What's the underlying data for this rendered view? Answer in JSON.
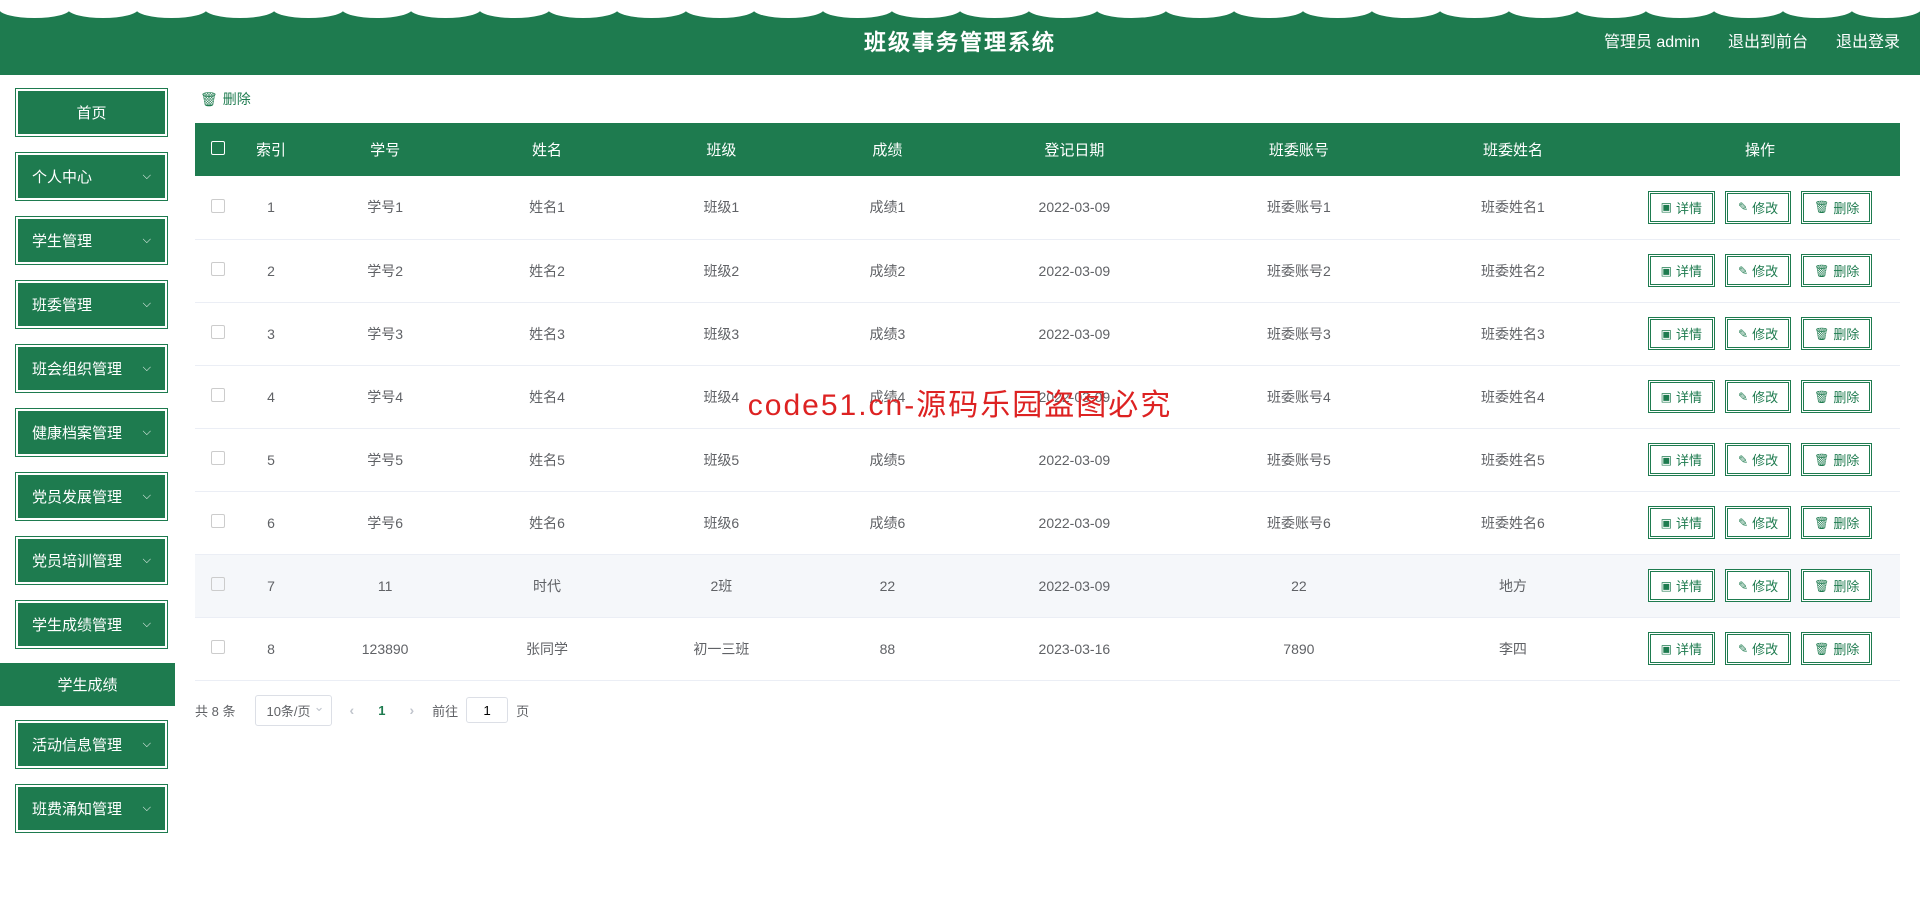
{
  "header": {
    "title": "班级事务管理系统"
  },
  "nav": {
    "admin": "管理员 admin",
    "front": "退出到前台",
    "logout": "退出登录"
  },
  "sidebar": {
    "items": [
      {
        "label": "首页",
        "expandable": false
      },
      {
        "label": "个人中心",
        "expandable": true
      },
      {
        "label": "学生管理",
        "expandable": true
      },
      {
        "label": "班委管理",
        "expandable": true
      },
      {
        "label": "班会组织管理",
        "expandable": true
      },
      {
        "label": "健康档案管理",
        "expandable": true
      },
      {
        "label": "党员发展管理",
        "expandable": true
      },
      {
        "label": "党员培训管理",
        "expandable": true
      },
      {
        "label": "学生成绩管理",
        "expandable": true,
        "expanded": true
      },
      {
        "label": "活动信息管理",
        "expandable": true
      },
      {
        "label": "班费涌知管理",
        "expandable": true
      }
    ],
    "submenu": "学生成绩"
  },
  "toolbar": {
    "delete": "删除"
  },
  "table": {
    "headers": {
      "index": "索引",
      "studentId": "学号",
      "name": "姓名",
      "className": "班级",
      "grade": "成绩",
      "date": "登记日期",
      "committeeAccount": "班委账号",
      "committeeName": "班委姓名",
      "operation": "操作"
    },
    "rows": [
      {
        "index": "1",
        "studentId": "学号1",
        "name": "姓名1",
        "className": "班级1",
        "grade": "成绩1",
        "date": "2022-03-09",
        "committeeAccount": "班委账号1",
        "committeeName": "班委姓名1"
      },
      {
        "index": "2",
        "studentId": "学号2",
        "name": "姓名2",
        "className": "班级2",
        "grade": "成绩2",
        "date": "2022-03-09",
        "committeeAccount": "班委账号2",
        "committeeName": "班委姓名2"
      },
      {
        "index": "3",
        "studentId": "学号3",
        "name": "姓名3",
        "className": "班级3",
        "grade": "成绩3",
        "date": "2022-03-09",
        "committeeAccount": "班委账号3",
        "committeeName": "班委姓名3"
      },
      {
        "index": "4",
        "studentId": "学号4",
        "name": "姓名4",
        "className": "班级4",
        "grade": "成绩4",
        "date": "2022-03-09",
        "committeeAccount": "班委账号4",
        "committeeName": "班委姓名4"
      },
      {
        "index": "5",
        "studentId": "学号5",
        "name": "姓名5",
        "className": "班级5",
        "grade": "成绩5",
        "date": "2022-03-09",
        "committeeAccount": "班委账号5",
        "committeeName": "班委姓名5"
      },
      {
        "index": "6",
        "studentId": "学号6",
        "name": "姓名6",
        "className": "班级6",
        "grade": "成绩6",
        "date": "2022-03-09",
        "committeeAccount": "班委账号6",
        "committeeName": "班委姓名6"
      },
      {
        "index": "7",
        "studentId": "11",
        "name": "时代",
        "className": "2班",
        "grade": "22",
        "date": "2022-03-09",
        "committeeAccount": "22",
        "committeeName": "地方"
      },
      {
        "index": "8",
        "studentId": "123890",
        "name": "张同学",
        "className": "初一三班",
        "grade": "88",
        "date": "2023-03-16",
        "committeeAccount": "7890",
        "committeeName": "李四"
      }
    ]
  },
  "actions": {
    "detail": "详情",
    "edit": "修改",
    "delete": "删除"
  },
  "pager": {
    "total": "共 8 条",
    "perPage": "10条/页",
    "prev": "‹",
    "current": "1",
    "next": "›",
    "jumpLabel": "前往",
    "jumpValue": "1",
    "pageUnit": "页"
  },
  "watermark": "code51.cn-源码乐园盗图必究"
}
